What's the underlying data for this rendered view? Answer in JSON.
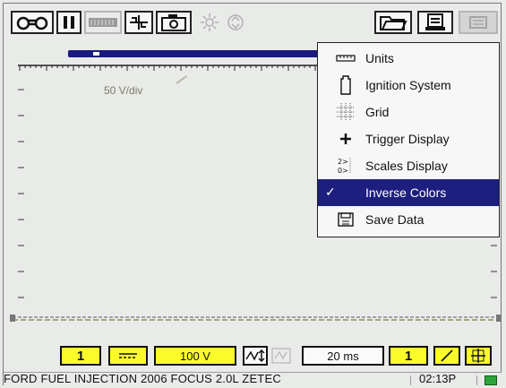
{
  "toolbar": {
    "icons": [
      "binoculars-icon",
      "pause-icon",
      "film-strip-icon",
      "cursor-split-icon",
      "camera-icon",
      "brightness-icon",
      "refresh-icon",
      "folder-icon",
      "printer-icon",
      "tools-icon"
    ]
  },
  "trace": {
    "scale_label": "50 V/div"
  },
  "menu": {
    "items": [
      {
        "label": "Units",
        "icon": "ruler-icon"
      },
      {
        "label": "Ignition System",
        "icon": "spark-plug-icon"
      },
      {
        "label": "Grid",
        "icon": "grid-icon"
      },
      {
        "label": "Trigger Display",
        "icon": "crosshair-plus-icon"
      },
      {
        "label": "Scales Display",
        "icon": "scale-labels-icon"
      },
      {
        "label": "Inverse Colors",
        "icon": "checkmark-icon",
        "selected": true
      },
      {
        "label": "Save Data",
        "icon": "save-disk-icon"
      }
    ]
  },
  "controls": {
    "channel": "1",
    "coupling": "==",
    "voltage": "100 V",
    "time": "20 ms",
    "trigger_channel": "1"
  },
  "status": {
    "vehicle": "FORD FUEL INJECTION 2006 FOCUS 2.0L ZETEC",
    "time": "02:13P"
  },
  "colors": {
    "selection": "#1d1f7e",
    "button_yellow": "#fbfb2a",
    "timeline": "#1a1a80",
    "battery": "#2ea53b"
  }
}
